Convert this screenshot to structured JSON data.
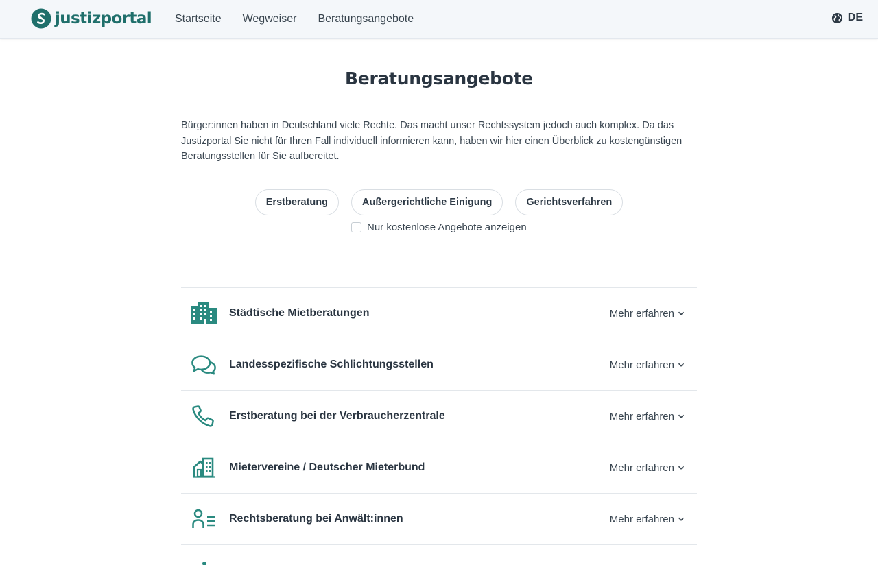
{
  "colors": {
    "brand": "#1f6f6b",
    "icon_teal": "#2a8a80",
    "text": "#2e3a46",
    "header_bg": "#f4f7fa"
  },
  "header": {
    "logo_text": "justizportal",
    "nav": [
      "Startseite",
      "Wegweiser",
      "Beratungsangebote"
    ],
    "language": "DE"
  },
  "main": {
    "title": "Beratungsangebote",
    "intro": "Bürger:innen haben in Deutschland viele Rechte. Das macht unser Rechtssystem jedoch auch komplex. Da das Justizportal Sie nicht für Ihren Fall individuell informieren kann, haben wir hier einen Überblick zu kostengünstigen Beratungsstellen für Sie aufbereitet.",
    "filters": [
      "Erstberatung",
      "Außergerichtliche Einigung",
      "Gerichtsverfahren"
    ],
    "free_only_label": "Nur kostenlose Angebote anzeigen",
    "free_only_checked": false
  },
  "offers": [
    {
      "title": "Städtische Mietberatungen",
      "icon": "city-buildings-icon",
      "more": "Mehr erfahren"
    },
    {
      "title": "Landesspezifische Schlichtungsstellen",
      "icon": "chat-bubbles-icon",
      "more": "Mehr erfahren"
    },
    {
      "title": "Erstberatung bei der Verbraucherzentrale",
      "icon": "phone-icon",
      "more": "Mehr erfahren"
    },
    {
      "title": "Mietervereine / Deutscher Mieterbund",
      "icon": "building-icon",
      "more": "Mehr erfahren"
    },
    {
      "title": "Rechtsberatung bei Anwält:innen",
      "icon": "person-list-icon",
      "more": "Mehr erfahren"
    }
  ]
}
